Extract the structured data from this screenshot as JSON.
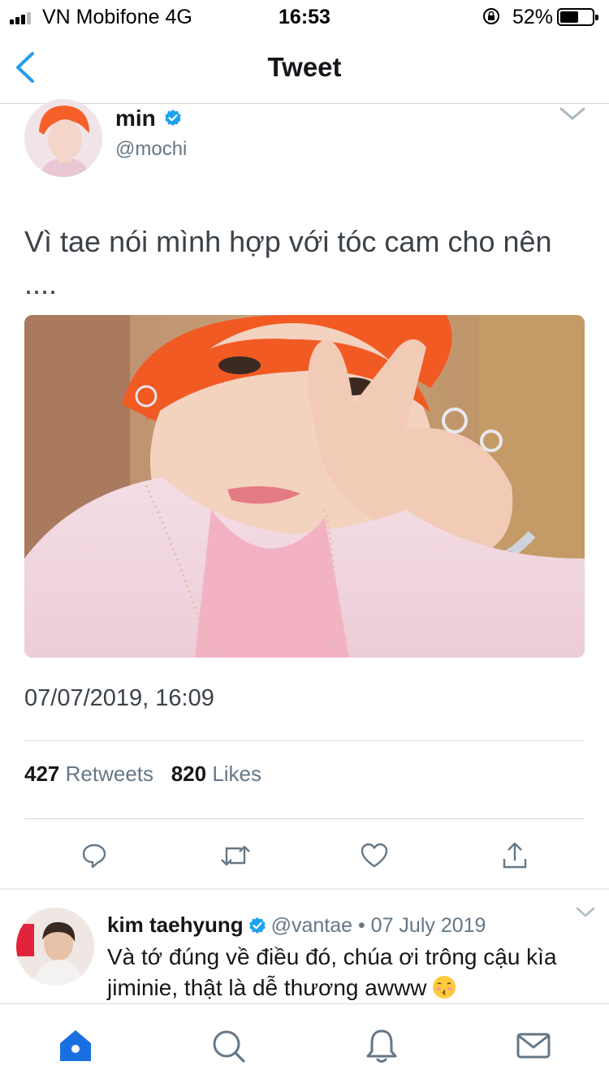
{
  "status_bar": {
    "carrier": "VN Mobifone  4G",
    "time": "16:53",
    "battery": "52%",
    "battery_level": 0.52
  },
  "nav": {
    "title": "Tweet",
    "back_icon": "chevron-left-icon"
  },
  "tweet": {
    "author_name": "min",
    "author_handle": "@mochi",
    "text": "Vì tae nói mình hợp với tóc cam cho nên ....",
    "timestamp": "07/07/2019, 16:09",
    "stats": {
      "retweets_count": "427",
      "retweets_label": "Retweets",
      "likes_count": "820",
      "likes_label": "Likes"
    },
    "actions": [
      "reply-icon",
      "retweet-icon",
      "like-icon",
      "share-icon"
    ]
  },
  "reply": {
    "author_name": "kim taehyung",
    "meta": "@vantae • 07 July 2019",
    "text": "Và tớ đúng về điều đó, chúa ơi trông cậu kìa jiminie, thật là dễ thương awww"
  },
  "tab_bar": {
    "tabs": [
      "home-icon",
      "search-icon",
      "notifications-icon",
      "messages-icon"
    ],
    "active": "home-icon"
  },
  "colors": {
    "accent": "#1da1f2",
    "nav_blue": "#2a6fd6",
    "secondary_text": "#657786",
    "icon_gray": "#657786"
  }
}
